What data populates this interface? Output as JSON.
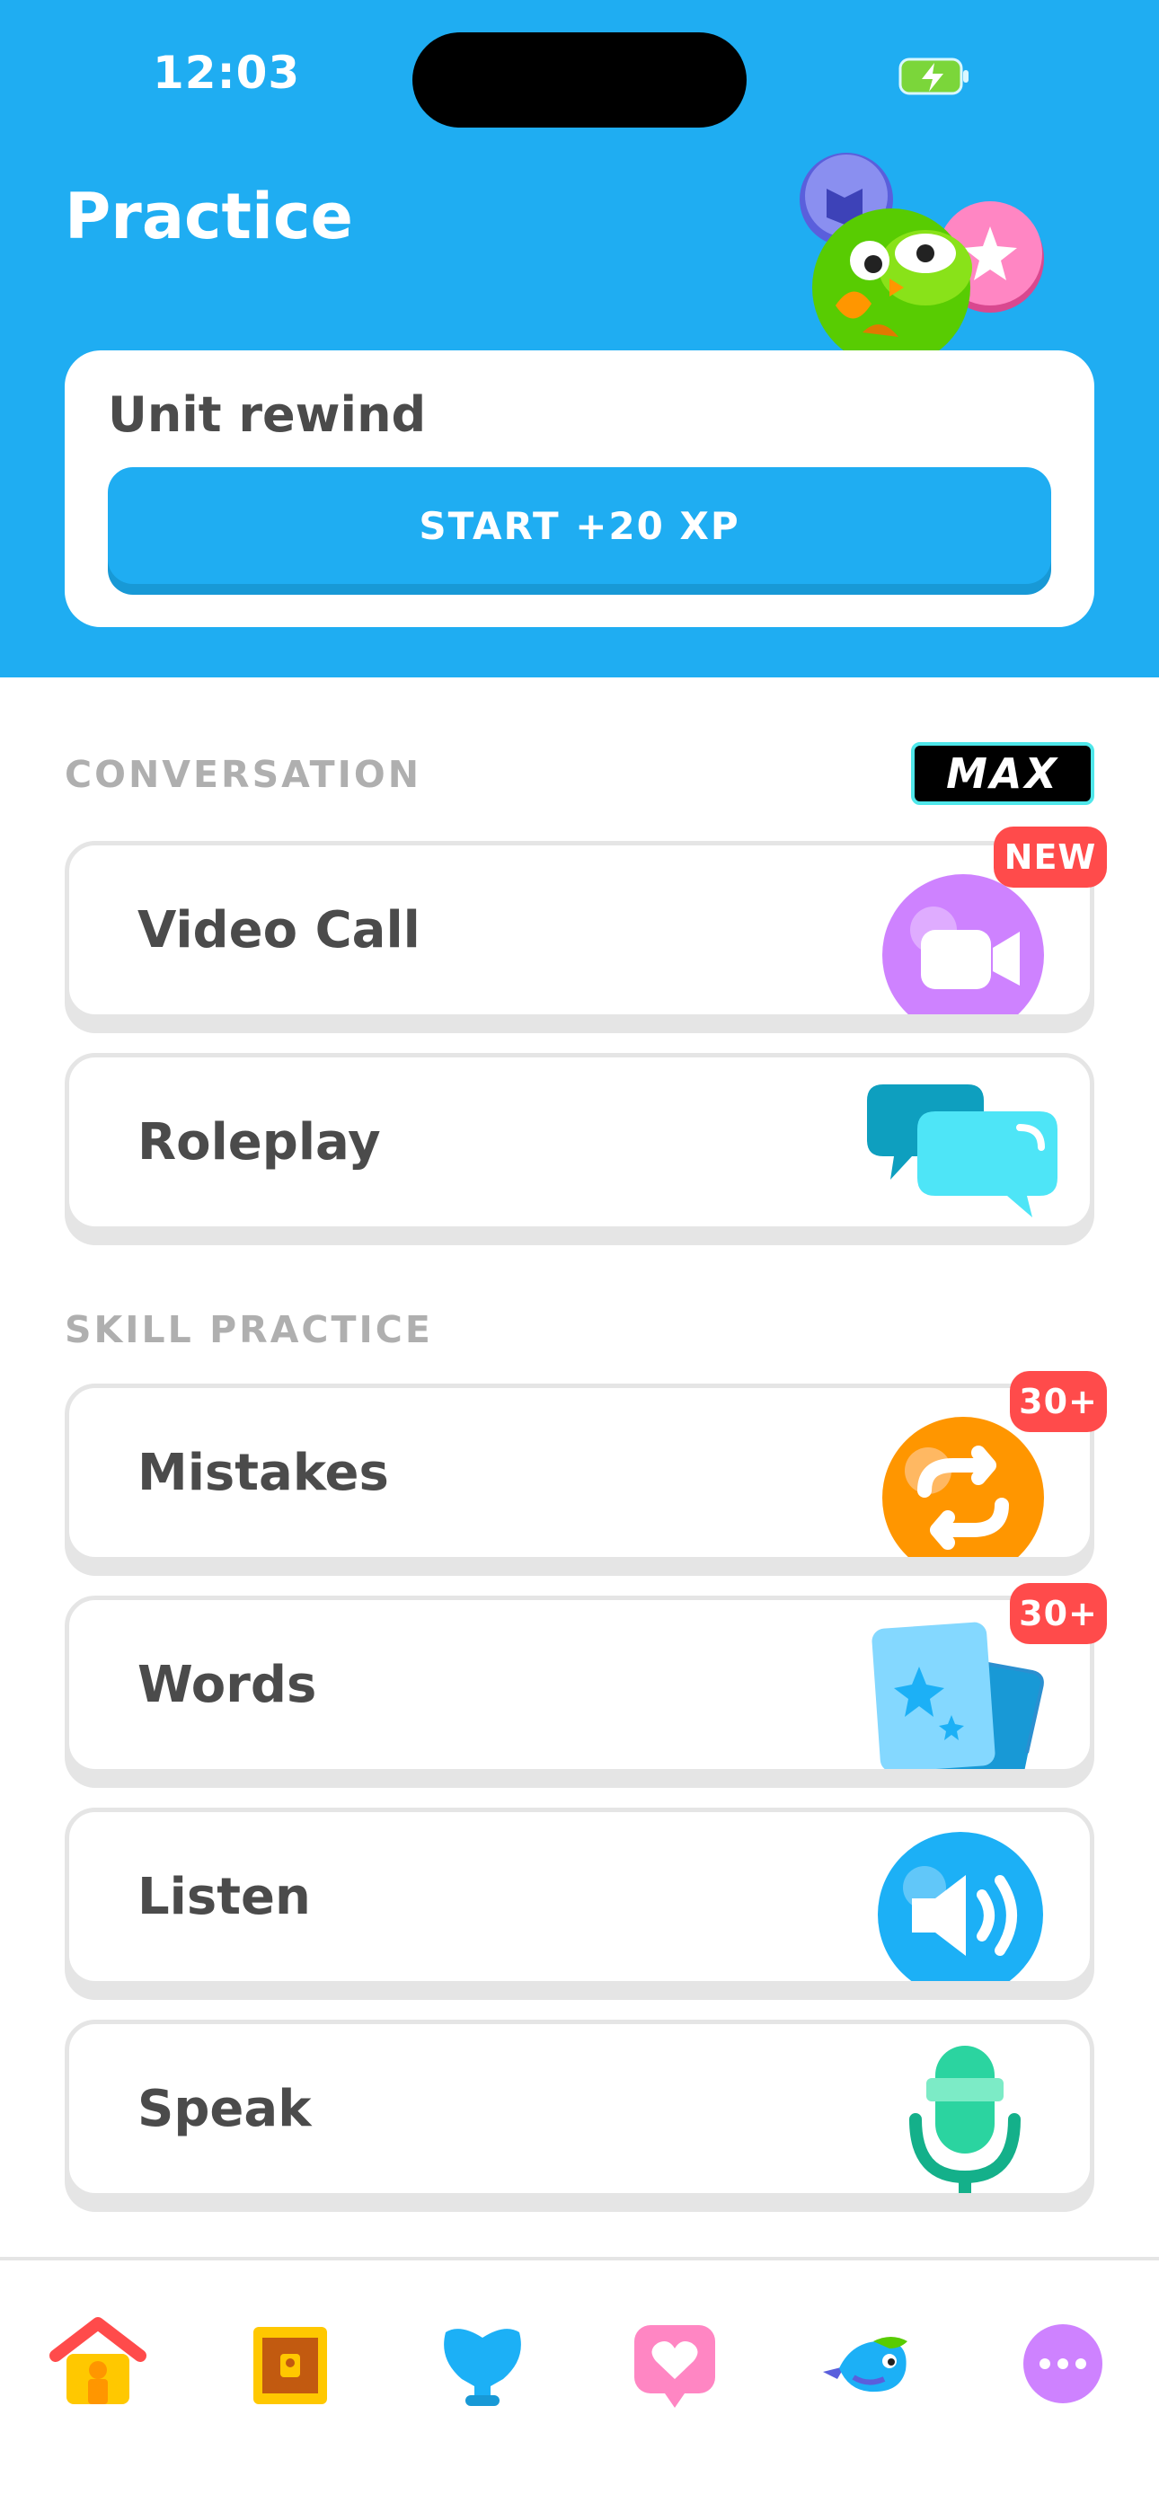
{
  "status_bar": {
    "time": "12:03"
  },
  "header": {
    "title": "Practice"
  },
  "rewind": {
    "label": "Unit rewind",
    "button": "START +20 XP"
  },
  "conversation": {
    "title": "CONVERSATION",
    "plan_badge": "MAX",
    "items": [
      {
        "label": "Video Call",
        "badge": "NEW",
        "icon": "video-camera-icon"
      },
      {
        "label": "Roleplay",
        "icon": "chat-bubbles-icon"
      }
    ]
  },
  "skill_practice": {
    "title": "SKILL PRACTICE",
    "items": [
      {
        "label": "Mistakes",
        "badge": "30+",
        "icon": "repeat-arrows-icon"
      },
      {
        "label": "Words",
        "badge": "30+",
        "icon": "flashcards-icon"
      },
      {
        "label": "Listen",
        "icon": "speaker-icon"
      },
      {
        "label": "Speak",
        "icon": "microphone-icon"
      }
    ]
  },
  "tab_bar": [
    {
      "name": "learn",
      "icon": "home-icon"
    },
    {
      "name": "chest",
      "icon": "treasure-chest-icon"
    },
    {
      "name": "practice",
      "icon": "dumbbell-icon"
    },
    {
      "name": "friends",
      "icon": "heart-icon"
    },
    {
      "name": "shop",
      "icon": "bird-icon"
    },
    {
      "name": "more",
      "icon": "more-icon"
    }
  ],
  "colors": {
    "accent": "#1fadf2",
    "badge_red": "#ff4b4b",
    "text": "#4b4b4b",
    "muted": "#afafaf"
  }
}
